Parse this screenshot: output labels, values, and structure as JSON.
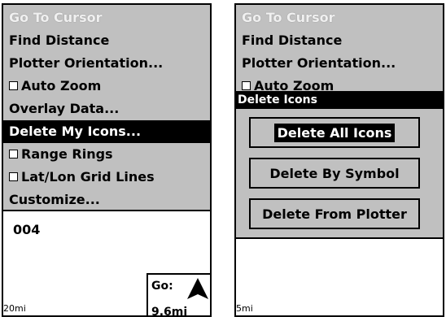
{
  "left": {
    "menu": {
      "items": [
        {
          "label": "Go To Cursor",
          "state": "disabled"
        },
        {
          "label": "Find Distance",
          "state": "normal"
        },
        {
          "label": "Plotter Orientation...",
          "state": "normal"
        },
        {
          "label": "Auto Zoom",
          "state": "checkbox"
        },
        {
          "label": "Overlay Data...",
          "state": "normal"
        },
        {
          "label": "Delete My Icons...",
          "state": "selected"
        },
        {
          "label": "Range Rings",
          "state": "checkbox"
        },
        {
          "label": "Lat/Lon Grid Lines",
          "state": "checkbox"
        },
        {
          "label": "Customize...",
          "state": "normal"
        }
      ]
    },
    "map": {
      "waypoint_label": "004",
      "scale": "20mi",
      "go_label": "Go:",
      "go_distance": "9.6mi"
    }
  },
  "right": {
    "menu": {
      "items": [
        {
          "label": "Go To Cursor"
        },
        {
          "label": "Find Distance"
        },
        {
          "label": "Plotter Orientation..."
        },
        {
          "label": "Auto Zoom"
        }
      ]
    },
    "dialog": {
      "title": "Delete Icons",
      "buttons": [
        {
          "label": "Delete All Icons"
        },
        {
          "label": "Delete By Symbol"
        },
        {
          "label": "Delete From Plotter"
        }
      ]
    },
    "map": {
      "scale": "5mi"
    }
  }
}
